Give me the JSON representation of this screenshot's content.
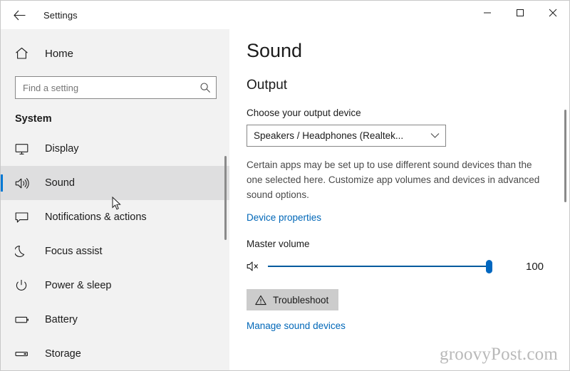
{
  "window": {
    "title": "Settings",
    "back_label": "Back",
    "controls": {
      "minimize": "Minimize",
      "maximize": "Maximize",
      "close": "Close"
    }
  },
  "sidebar": {
    "home_label": "Home",
    "home_icon": "home-icon",
    "search": {
      "placeholder": "Find a setting",
      "value": "",
      "icon": "search-icon"
    },
    "section_title": "System",
    "items": [
      {
        "label": "Display",
        "icon": "monitor-icon",
        "selected": false
      },
      {
        "label": "Sound",
        "icon": "speaker-icon",
        "selected": true
      },
      {
        "label": "Notifications & actions",
        "icon": "message-icon",
        "selected": false
      },
      {
        "label": "Focus assist",
        "icon": "moon-icon",
        "selected": false
      },
      {
        "label": "Power & sleep",
        "icon": "power-icon",
        "selected": false
      },
      {
        "label": "Battery",
        "icon": "battery-icon",
        "selected": false
      },
      {
        "label": "Storage",
        "icon": "storage-icon",
        "selected": false
      }
    ]
  },
  "main": {
    "page_title": "Sound",
    "output": {
      "group_title": "Output",
      "device_label": "Choose your output device",
      "device_value": "Speakers / Headphones (Realtek...",
      "dropdown_icon": "chevron-down-icon",
      "description": "Certain apps may be set up to use different sound devices than the one selected here. Customize app volumes and devices in advanced sound options.",
      "device_properties_link": "Device properties",
      "volume_label": "Master volume",
      "volume_value": "100",
      "volume_percent": 100,
      "mute_icon": "speaker-mute-icon",
      "troubleshoot_label": "Troubleshoot",
      "troubleshoot_icon": "warning-triangle-icon",
      "manage_devices_link": "Manage sound devices"
    }
  },
  "watermark": "groovyPost.com",
  "colors": {
    "accent": "#0078d4",
    "link": "#0067b8",
    "slider": "#0067c0",
    "sidebar_bg": "#f2f2f2",
    "selected_bg": "#dededf",
    "button_bg": "#cccccc"
  }
}
